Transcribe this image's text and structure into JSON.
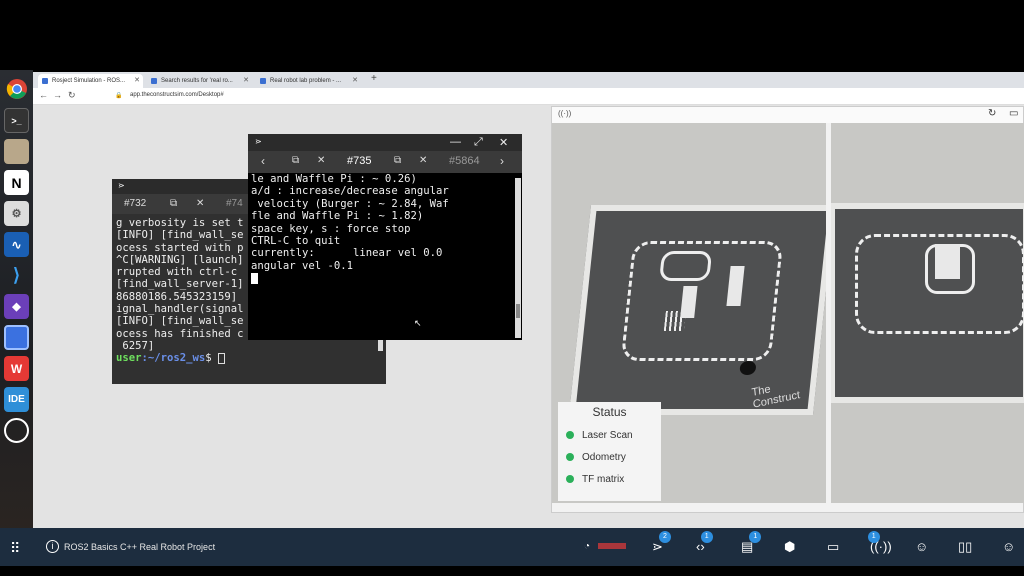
{
  "browser": {
    "tabs": [
      {
        "label": "Rosject Simulation - ROS...",
        "active": true
      },
      {
        "label": "Search results for 'real ro..."
      },
      {
        "label": "Real robot lab problem - ..."
      }
    ],
    "url": "app.theconstructsim.com/Desktop#"
  },
  "terminal1": {
    "tabs": [
      "#732",
      "#74"
    ],
    "lines": [
      "g verbosity is set t",
      "[INFO] [find_wall_se",
      "ocess started with p",
      "^C[WARNING] [launch]",
      "rrupted with ctrl-c",
      "[find_wall_server-1]",
      "86880186.545323159]",
      "ignal_handler(signal",
      "[INFO] [find_wall_se",
      "ocess has finished c",
      " 6257]"
    ],
    "prompt_user": "user",
    "prompt_path": ":~/ros2_ws",
    "prompt_symbol": "$ "
  },
  "terminal2": {
    "tabs": [
      "#735",
      "#5864"
    ],
    "lines": [
      "le and Waffle Pi : ~ 0.26)",
      "a/d : increase/decrease angular",
      " velocity (Burger : ~ 2.84, Waf",
      "fle and Waffle Pi : ~ 1.82)",
      "",
      "space key, s : force stop",
      "",
      "CTRL-C to quit",
      "",
      "currently:      linear vel 0.0",
      "angular vel -0.1"
    ]
  },
  "video": {
    "watermark": "The Construct",
    "status_title": "Status",
    "status_items": [
      "Laser Scan",
      "Odometry",
      "TF matrix"
    ],
    "status_color": "#2bb05a"
  },
  "bottombar": {
    "project_name": "ROS2 Basics C++ Real Robot Project",
    "icons": [
      {
        "name": "terminal-icon",
        "badge": "2"
      },
      {
        "name": "code-icon",
        "badge": "1"
      },
      {
        "name": "notebook-icon",
        "badge": "1"
      },
      {
        "name": "cube-icon"
      },
      {
        "name": "monitor-icon"
      },
      {
        "name": "antenna-icon",
        "badge": "1"
      },
      {
        "name": "robot-icon"
      },
      {
        "name": "book-icon"
      },
      {
        "name": "robot2-icon"
      }
    ]
  }
}
